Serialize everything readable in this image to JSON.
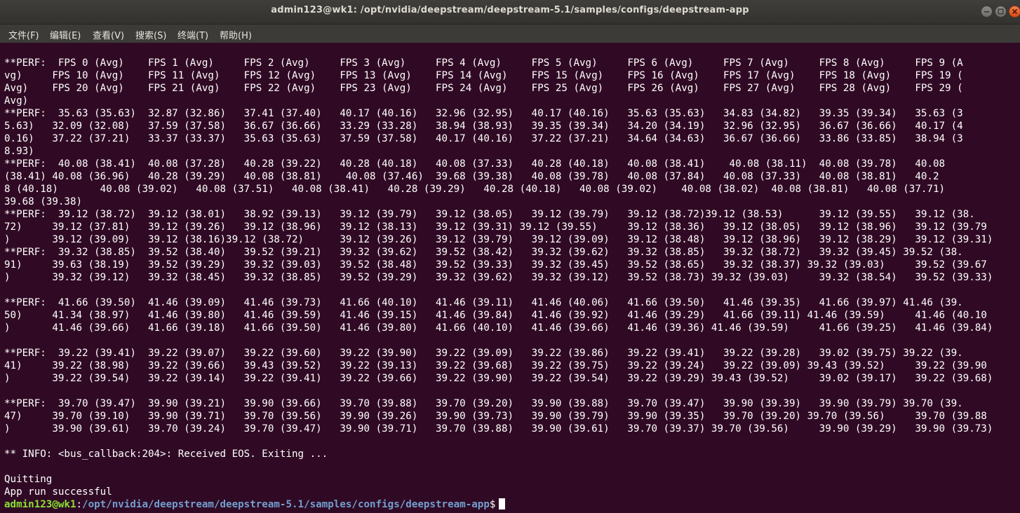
{
  "window": {
    "title": "admin123@wk1: /opt/nvidia/deepstream/deepstream-5.1/samples/configs/deepstream-app"
  },
  "window_controls": [
    "minimize",
    "maximize",
    "close"
  ],
  "menubar": {
    "items": [
      {
        "label": "文件(F)"
      },
      {
        "label": "编辑(E)"
      },
      {
        "label": "查看(V)"
      },
      {
        "label": "搜索(S)"
      },
      {
        "label": "终端(T)"
      },
      {
        "label": "帮助(H)"
      }
    ]
  },
  "terminal": {
    "lines": [
      "**PERF:  FPS 0 (Avg)\tFPS 1 (Avg)\tFPS 2 (Avg)\tFPS 3 (Avg)\tFPS 4 (Avg)\tFPS 5 (Avg)\tFPS 6 (Avg)\tFPS 7 (Avg)\tFPS 8 (Avg)\tFPS 9 (A",
      "vg)\tFPS 10 (Avg)\tFPS 11 (Avg)\tFPS 12 (Avg)\tFPS 13 (Avg)\tFPS 14 (Avg)\tFPS 15 (Avg)\tFPS 16 (Avg)\tFPS 17 (Avg)\tFPS 18 (Avg)\tFPS 19 (",
      "Avg)\tFPS 20 (Avg)\tFPS 21 (Avg)\tFPS 22 (Avg)\tFPS 23 (Avg)\tFPS 24 (Avg)\tFPS 25 (Avg)\tFPS 26 (Avg)\tFPS 27 (Avg)\tFPS 28 (Avg)\tFPS 29 (",
      "Avg)",
      "**PERF:  35.63 (35.63)\t32.87 (32.86)\t37.41 (37.40)\t40.17 (40.16)\t32.96 (32.95)\t40.17 (40.16)\t35.63 (35.63)\t34.83 (34.82)\t39.35 (39.34)\t35.63 (3",
      "5.63)\t32.09 (32.08)\t37.59 (37.58)\t36.67 (36.66)\t33.29 (33.28)\t38.94 (38.93)\t39.35 (39.34)\t34.20 (34.19)\t32.96 (32.95)\t36.67 (36.66)\t40.17 (4",
      "0.16)\t37.22 (37.21)\t33.37 (33.37)\t35.63 (35.63)\t37.59 (37.58)\t40.17 (40.16)\t37.22 (37.21)\t34.64 (34.63)\t36.67 (36.66)\t33.86 (33.85)\t38.94 (3",
      "8.93)",
      "**PERF:  40.08 (38.41)\t40.08 (37.28)\t40.28 (39.22)\t40.28 (40.18)\t40.08 (37.33)\t40.28 (40.18)\t40.08 (38.41)\t 40.08 (38.11)\t40.08 (39.78)\t40.08 ",
      "(38.41)\t40.08 (36.96)\t40.28 (39.29)\t40.08 (38.81)\t 40.08 (37.46)\t39.68 (39.38)\t40.08 (39.78)\t40.08 (37.84)\t40.08 (37.33)\t40.08 (38.81)\t40.2",
      "8 (40.18)\t40.08 (39.02)\t40.08 (37.51)\t40.08 (38.41)\t40.28 (39.29)\t40.28 (40.18)\t40.08 (39.02)\t 40.08 (38.02)\t40.08 (38.81)\t40.08 (37.71)",
      "39.68 (39.38)",
      "**PERF:  39.12 (38.72)\t39.12 (38.01)\t38.92 (39.13)\t39.12 (39.79)\t39.12 (38.05)\t39.12 (39.79)\t39.12 (38.72)39.12 (38.53)\t39.12 (39.55)\t39.12 (38.",
      "72)\t39.12 (37.81)\t39.12 (39.26)\t39.12 (38.96)\t39.12 (38.13)\t39.12 (39.31) 39.12 (39.55)\t39.12 (38.36)\t39.12 (38.05)\t39.12 (38.96)\t39.12 (39.79",
      ")\t39.12 (39.09)\t39.12 (38.16)39.12 (38.72)\t39.12 (39.26)\t39.12 (39.79)\t39.12 (39.09)\t39.12 (38.48)\t39.12 (38.96)\t39.12 (38.29)\t39.12 (39.31)",
      "**PERF:  39.32 (38.85)\t39.52 (38.40)\t39.52 (39.21)\t39.32 (39.62)\t39.52 (38.42)\t39.32 (39.62)\t39.32 (38.85)\t39.32 (38.72)\t39.32 (39.45) 39.52 (38.",
      "91)\t39.63 (38.19)\t39.52 (39.29)\t39.32 (39.03)\t39.52 (38.48)\t39.52 (39.33)\t39.32 (39.45)\t39.52 (38.65)\t39.32 (38.37) 39.32 (39.03)\t39.52 (39.67",
      ")\t39.32 (39.12)\t39.32 (38.45)\t39.32 (38.85)\t39.52 (39.29)\t39.32 (39.62)\t39.32 (39.12)\t39.52 (38.73) 39.32 (39.03)\t39.32 (38.54)\t39.52 (39.33)",
      "",
      "**PERF:  41.66 (39.50)\t41.46 (39.09)\t41.46 (39.73)\t41.66 (40.10)\t41.46 (39.11)\t41.46 (40.06)\t41.66 (39.50)\t41.46 (39.35)\t41.66 (39.97) 41.46 (39.",
      "50)\t41.34 (38.97)\t41.46 (39.80)\t41.46 (39.59)\t41.46 (39.15)\t41.46 (39.84)\t41.46 (39.92)\t41.46 (39.29)\t41.66 (39.11) 41.46 (39.59)\t41.46 (40.10",
      ")\t41.46 (39.66)\t41.66 (39.18)\t41.66 (39.50)\t41.46 (39.80)\t41.66 (40.10)\t41.46 (39.66)\t41.46 (39.36) 41.46 (39.59)\t41.66 (39.25)\t41.46 (39.84)",
      "",
      "**PERF:  39.22 (39.41)\t39.22 (39.07)\t39.22 (39.60)\t39.22 (39.90)\t39.22 (39.09)\t39.22 (39.86)\t39.22 (39.41)\t39.22 (39.28)\t39.02 (39.75) 39.22 (39.",
      "41)\t39.22 (38.98)\t39.22 (39.66)\t39.43 (39.52)\t39.22 (39.13)\t39.22 (39.68)\t39.22 (39.75)\t39.22 (39.24)\t39.22 (39.09) 39.43 (39.52)\t39.22 (39.90",
      ")\t39.22 (39.54)\t39.22 (39.14)\t39.22 (39.41)\t39.22 (39.66)\t39.22 (39.90)\t39.22 (39.54)\t39.22 (39.29) 39.43 (39.52)\t39.02 (39.17)\t39.22 (39.68)",
      "",
      "**PERF:  39.70 (39.47)\t39.90 (39.21)\t39.90 (39.66)\t39.70 (39.88)\t39.70 (39.20)\t39.90 (39.88)\t39.70 (39.47)\t39.90 (39.39)\t39.90 (39.79) 39.70 (39.",
      "47)\t39.70 (39.10)\t39.90 (39.71)\t39.70 (39.56)\t39.90 (39.26)\t39.90 (39.73)\t39.90 (39.79)\t39.90 (39.35)\t39.70 (39.20) 39.70 (39.56)\t39.70 (39.88",
      ")\t39.90 (39.61)\t39.70 (39.24)\t39.70 (39.47)\t39.90 (39.71)\t39.70 (39.88)\t39.90 (39.61)\t39.70 (39.37) 39.70 (39.56)\t39.90 (39.29)\t39.90 (39.73)",
      "",
      "** INFO: <bus_callback:204>: Received EOS. Exiting ...",
      "",
      "Quitting",
      "App run successful"
    ],
    "prompt": {
      "user_host": "admin123@wk1",
      "separator": ":",
      "path": "/opt/nvidia/deepstream/deepstream-5.1/samples/configs/deepstream-app",
      "symbol": "$"
    }
  },
  "colors": {
    "background": "#300a24",
    "prompt_user": "#8ae234",
    "prompt_path": "#729fcf",
    "text": "#ffffff"
  }
}
